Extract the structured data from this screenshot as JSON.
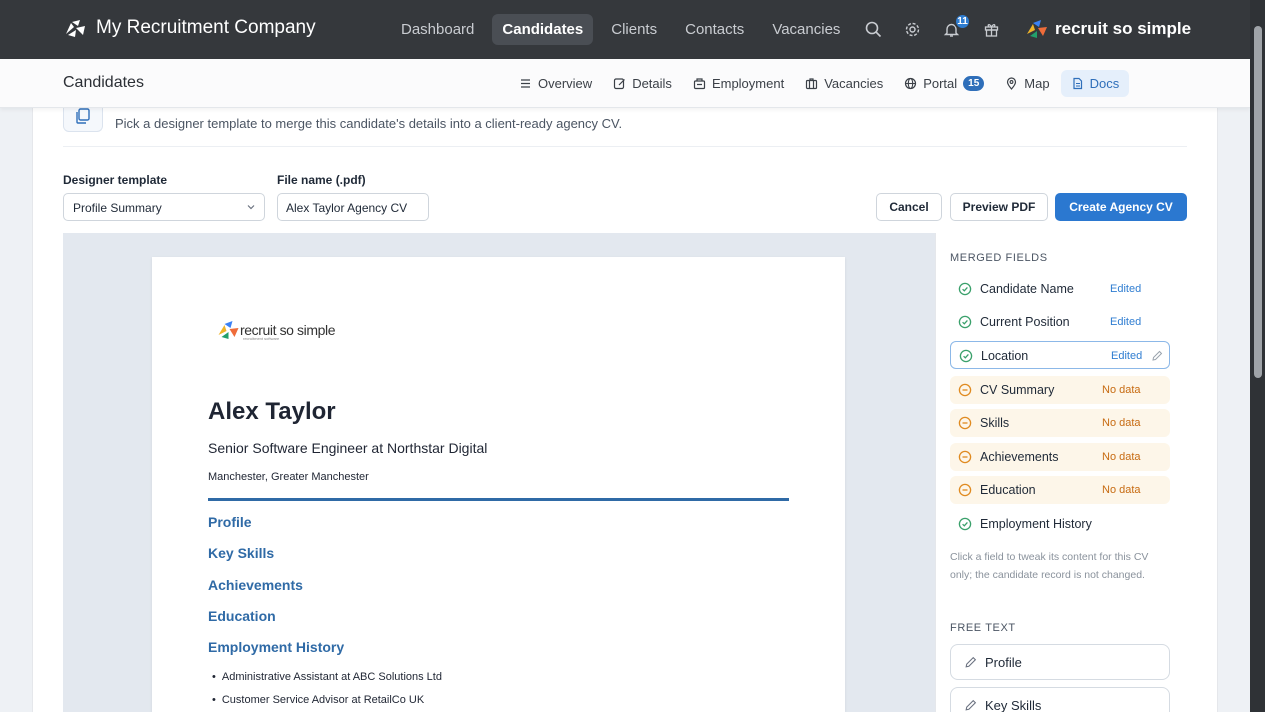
{
  "nav": {
    "company": "My Recruitment Company",
    "links": [
      "Dashboard",
      "Candidates",
      "Clients",
      "Contacts",
      "Vacancies"
    ],
    "active": "Candidates",
    "notifications_count": "11",
    "product_logo": "recruit so simple",
    "icons": [
      "search-icon",
      "gear-icon",
      "bell-icon",
      "gift-icon"
    ]
  },
  "subbar": {
    "title": "Candidates",
    "tabs": [
      {
        "label": "Overview",
        "icon": "list-icon"
      },
      {
        "label": "Details",
        "icon": "edit-icon"
      },
      {
        "label": "Employment",
        "icon": "building-icon"
      },
      {
        "label": "Vacancies",
        "icon": "briefcase-icon"
      },
      {
        "label": "Portal",
        "icon": "globe-icon",
        "count": "15"
      },
      {
        "label": "Map",
        "icon": "pin-icon"
      },
      {
        "label": "Docs",
        "icon": "document-icon"
      }
    ],
    "active_tab": "Docs"
  },
  "card": {
    "description": "Pick a designer template to merge this candidate's details into a client-ready agency CV.",
    "template_label": "Designer template",
    "template_value": "Profile Summary",
    "filename_label": "File name (.pdf)",
    "filename_value": "Alex Taylor Agency CV",
    "cancel_label": "Cancel",
    "preview_label": "Preview PDF",
    "create_label": "Create Agency CV"
  },
  "cv": {
    "logo_text": "recruit so simple",
    "logo_subtext": "recruitment software",
    "name": "Alex Taylor",
    "position": "Senior Software Engineer at Northstar Digital",
    "location": "Manchester, Greater Manchester",
    "sections": [
      "Profile",
      "Key Skills",
      "Achievements",
      "Education",
      "Employment History"
    ],
    "employment": [
      "Administrative Assistant at ABC Solutions Ltd",
      "Customer Service Advisor at RetailCo UK"
    ]
  },
  "side": {
    "merged_heading": "MERGED FIELDS",
    "fields": [
      {
        "name": "Candidate Name",
        "status": "Edited",
        "state": "ok"
      },
      {
        "name": "Current Position",
        "status": "Edited",
        "state": "ok"
      },
      {
        "name": "Location",
        "status": "Edited",
        "state": "selected"
      },
      {
        "name": "CV Summary",
        "status": "No data",
        "state": "warn"
      },
      {
        "name": "Skills",
        "status": "No data",
        "state": "warn"
      },
      {
        "name": "Achievements",
        "status": "No data",
        "state": "warn"
      },
      {
        "name": "Education",
        "status": "No data",
        "state": "warn"
      },
      {
        "name": "Employment History",
        "status": "",
        "state": "ok"
      }
    ],
    "note": "Click a field to tweak its content for this CV only; the candidate record is not changed.",
    "free_text_heading": "FREE TEXT",
    "free_text_items": [
      "Profile",
      "Key Skills"
    ]
  },
  "colors": {
    "nav_bg": "#35383c",
    "accent": "#2b78d0",
    "cv_heading": "#2f6aa6",
    "ok_green": "#3aa06b",
    "warn_orange": "#e08a1f"
  }
}
